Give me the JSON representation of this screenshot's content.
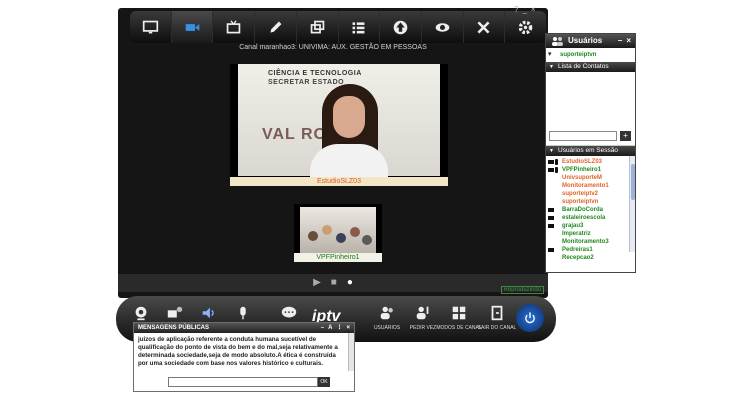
{
  "toolbar": {
    "buttons": [
      {
        "name": "monitor-icon",
        "active": false
      },
      {
        "name": "video-camera-icon",
        "active": true
      },
      {
        "name": "tv-icon",
        "active": false
      },
      {
        "name": "pencil-icon",
        "active": false
      },
      {
        "name": "windows-icon",
        "active": false
      },
      {
        "name": "list-icon",
        "active": false
      },
      {
        "name": "upload-icon",
        "active": false
      },
      {
        "name": "eye-icon",
        "active": false
      },
      {
        "name": "tools-icon",
        "active": false
      },
      {
        "name": "gear-icon",
        "active": false
      }
    ],
    "window_controls": [
      "?",
      "_",
      "×"
    ]
  },
  "channel": {
    "title": "Canal maranhao3: UNIVIMA: AUX. GESTÃO EM PESSOAS"
  },
  "main_video": {
    "banner_line1": "CIÊNCIA E TECNOLOGIA",
    "banner_line2": "SECRETAR      ESTADO",
    "banner_line3": "VAL        RO",
    "label": "EstudioSLZ03"
  },
  "thumb_video": {
    "label": "VPFPinheiro1"
  },
  "player": {
    "play_icon": "▶",
    "stop_icon": "■",
    "record_icon": "●",
    "status": "Reproduzindo"
  },
  "bottom_bar": {
    "logo": "iptv",
    "buttons": [
      {
        "id": "users",
        "label": "USUÁRIOS"
      },
      {
        "id": "ask",
        "label": "PEDIR VEZ"
      },
      {
        "id": "modes",
        "label": "MODOS DE CANAL"
      },
      {
        "id": "exit",
        "label": "SAIR DO CANAL"
      }
    ]
  },
  "messages": {
    "title": "MENSAGENS PÚBLICAS",
    "header_controls": [
      "–",
      "A",
      "⋮",
      "×"
    ],
    "text": "juizos de aplicação referente a conduta humana sucetível de qualificação do ponto de vista do bem e do mal,seja relativamente a determinada sociedade,seja de modo absoluto.A ética é construída por uma sociedade com base nos valores histórico e culturais.",
    "input_value": "",
    "ok_label": "OK"
  },
  "users_panel": {
    "title": "Usuários",
    "controls": [
      "–",
      "×"
    ],
    "current_user": "suporteiptvn",
    "contacts_section": "Lista de Contatos",
    "add_label": "+",
    "session_section": "Usuários em Sessão",
    "session_users": [
      {
        "name": "EstudioSLZ03",
        "color": "#e0632a",
        "icons": 2
      },
      {
        "name": "VPFPinheiro1",
        "color": "#1f8a1f",
        "icons": 2
      },
      {
        "name": "UnivsuporteM",
        "color": "#e0632a",
        "icons": 0
      },
      {
        "name": "Monitoramento1",
        "color": "#e0632a",
        "icons": 0
      },
      {
        "name": "suporteiptv2",
        "color": "#e0632a",
        "icons": 0
      },
      {
        "name": "suporteiptvn",
        "color": "#e0632a",
        "icons": 0
      },
      {
        "name": "BarraDoCorda",
        "color": "#1f8a1f",
        "icons": 1
      },
      {
        "name": "estaleiroescola",
        "color": "#1f8a1f",
        "icons": 1
      },
      {
        "name": "grajau3",
        "color": "#1f8a1f",
        "icons": 1
      },
      {
        "name": "Imperatriz",
        "color": "#1f8a1f",
        "icons": 0
      },
      {
        "name": "Monitoramento3",
        "color": "#1f8a1f",
        "icons": 0
      },
      {
        "name": "Pedreiras1",
        "color": "#1f8a1f",
        "icons": 1
      },
      {
        "name": "Recepcao2",
        "color": "#1f8a1f",
        "icons": 0
      }
    ]
  }
}
